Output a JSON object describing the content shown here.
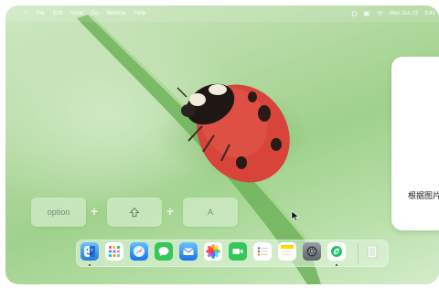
{
  "menubar": {
    "items": [
      "File",
      "Edit",
      "View",
      "Go",
      "Window",
      "Help"
    ],
    "date": "Mon Jun 22",
    "time": "9:41"
  },
  "shortcut": {
    "key1": "option",
    "plus": "+",
    "key2_icon": "shift-arrow",
    "key3": "A"
  },
  "notification": {
    "text": "根据图片"
  },
  "dock": {
    "apps": [
      "finder",
      "launchpad",
      "safari",
      "messages",
      "mail",
      "photos",
      "facetime",
      "reminders",
      "notes",
      "system-settings",
      "app-store-like",
      "trash"
    ]
  }
}
